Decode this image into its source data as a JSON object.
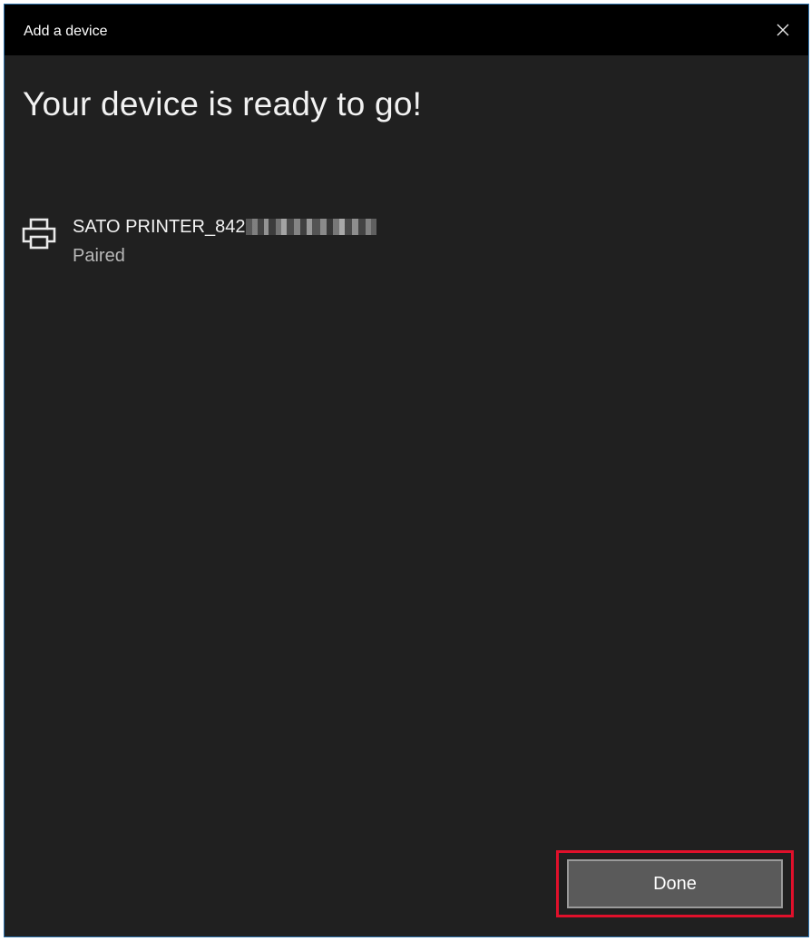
{
  "window": {
    "title": "Add a device"
  },
  "main": {
    "heading": "Your device is ready to go!"
  },
  "device": {
    "icon": "printer-icon",
    "name": "SATO PRINTER_842",
    "status": "Paired"
  },
  "actions": {
    "done_label": "Done",
    "highlight_color": "#e0102b"
  },
  "colors": {
    "background": "#202020",
    "titlebar": "#000000",
    "button": "#5a5a5a"
  }
}
